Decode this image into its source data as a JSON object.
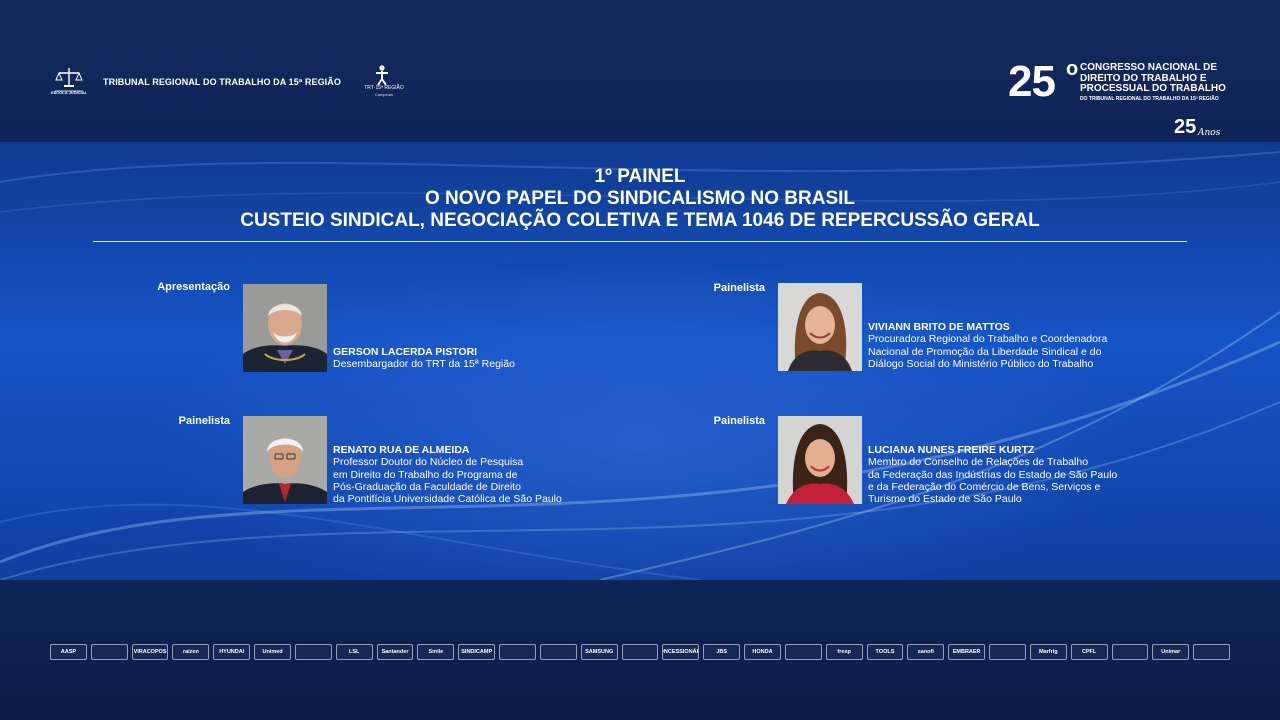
{
  "header": {
    "school_logo_label": "ESCOLA JUDICIAL",
    "court_name": "TRIBUNAL REGIONAL DO TRABALHO DA 15ª REGIÃO",
    "trt_logo_text": "TRT·15ª REGIÃO",
    "trt_logo_city": "Campinas",
    "congress_number": "25",
    "congress_degree": "o",
    "congress_line1": "CONGRESSO NACIONAL DE",
    "congress_line2": "DIREITO DO TRABALHO E",
    "congress_line3": "PROCESSUAL DO TRABALHO",
    "congress_sub": "DO TRIBUNAL REGIONAL DO TRABALHO DA 15ª REGIÃO",
    "anniversary_number": "25",
    "anniversary_word": "Anos"
  },
  "panel": {
    "line1": "1º PAINEL",
    "line2": "O NOVO PAPEL DO SINDICALISMO NO BRASIL",
    "line3": "CUSTEIO SINDICAL, NEGOCIAÇÃO COLETIVA E TEMA 1046 DE REPERCUSSÃO GERAL"
  },
  "speakers": [
    {
      "role": "Apresentação",
      "name": "GERSON LACERDA PISTORI",
      "lines": [
        "Desembargador do TRT da 15ª Região"
      ]
    },
    {
      "role": "Painelista",
      "name": "VIVIANN BRITO DE MATTOS",
      "lines": [
        "Procuradora Regional do Trabalho e Coordenadora",
        "Nacional de Promoção da Liberdade Sindical e do",
        "Diálogo Social do Ministério Público do Trabalho"
      ]
    },
    {
      "role": "Painelista",
      "name": "RENATO RUA DE ALMEIDA",
      "lines": [
        "Professor Doutor do Núcleo de Pesquisa",
        "em Direito do Trabalho do Programa de",
        "Pós-Graduação da Faculdade de Direito",
        "da Pontifícia Universidade Católica de São Paulo"
      ]
    },
    {
      "role": "Painelista",
      "name": "LUCIANA NUNES FREIRE KURTZ",
      "lines": [
        "Membro do Conselho de Relações de Trabalho",
        "da Federação das Indústrias do Estado de São Paulo",
        "e da Federação do Comércio de Bens, Serviços e",
        "Turismo do Estado de São Paulo"
      ]
    }
  ],
  "sponsors": [
    "AASP",
    "",
    "VIRACOPOS",
    "raízen",
    "HYUNDAI",
    "Unimed",
    "",
    "LSL",
    "Santander",
    "Smile",
    "SINDICAMP",
    "",
    "",
    "SAMSUNG",
    "",
    "CONCESSIONÁRIA",
    "JBS",
    "HONDA",
    "",
    "fresp",
    "TOOLS",
    "sanofi",
    "EMBRAER",
    "",
    "Marfrig",
    "CPFL",
    "",
    "Unimar",
    ""
  ]
}
